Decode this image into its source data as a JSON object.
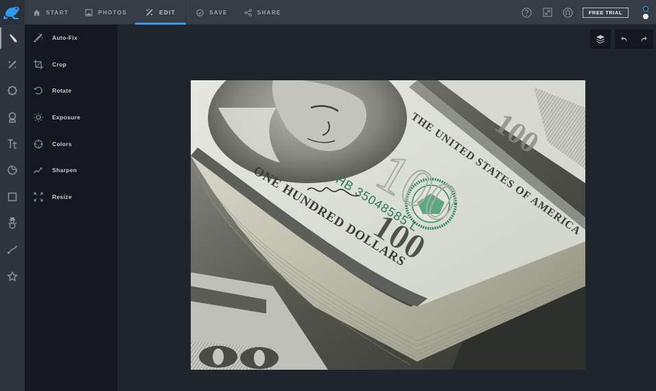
{
  "app": {
    "logo_icon": "frog-logo-icon",
    "accent_color": "#3d9ae0"
  },
  "topbar": {
    "nav": [
      {
        "label": "START",
        "icon": "home-icon",
        "active": false
      },
      {
        "label": "PHOTOS",
        "icon": "image-icon",
        "active": false
      },
      {
        "label": "EDIT",
        "icon": "magic-wand-icon",
        "active": true
      },
      {
        "label": "SAVE",
        "icon": "check-circle-icon",
        "active": false
      },
      {
        "label": "SHARE",
        "icon": "share-icon",
        "active": false
      }
    ],
    "right": {
      "help_icon": "help-icon",
      "fullscreen_icon": "fullscreen-icon",
      "account_icon": "account-icon",
      "free_trial_label": "FREE TRIAL"
    }
  },
  "rail": {
    "items": [
      {
        "name": "basic-edits",
        "icon": "pencil-icon",
        "active": true
      },
      {
        "name": "effects",
        "icon": "magic-wand-icon",
        "active": false
      },
      {
        "name": "frames",
        "icon": "gear-frame-icon",
        "active": false
      },
      {
        "name": "touch-up",
        "icon": "portrait-icon",
        "active": false
      },
      {
        "name": "text",
        "icon": "text-icon",
        "active": false
      },
      {
        "name": "overlays",
        "icon": "sticker-icon",
        "active": false
      },
      {
        "name": "borders",
        "icon": "square-icon",
        "active": false
      },
      {
        "name": "seasonal",
        "icon": "snowman-icon",
        "active": false
      },
      {
        "name": "draw",
        "icon": "brush-stroke-icon",
        "active": false
      },
      {
        "name": "favorites",
        "icon": "star-icon",
        "active": false
      }
    ]
  },
  "submenu": {
    "items": [
      {
        "label": "Auto-Fix",
        "icon": "auto-fix-icon"
      },
      {
        "label": "Crop",
        "icon": "crop-icon"
      },
      {
        "label": "Rotate",
        "icon": "rotate-icon"
      },
      {
        "label": "Exposure",
        "icon": "exposure-icon"
      },
      {
        "label": "Colors",
        "icon": "colors-icon"
      },
      {
        "label": "Sharpen",
        "icon": "sharpen-icon"
      },
      {
        "label": "Resize",
        "icon": "resize-icon"
      }
    ]
  },
  "canvas": {
    "tools": {
      "layers_icon": "layers-icon",
      "undo_icon": "undo-icon",
      "redo_icon": "redo-icon"
    },
    "photo": {
      "description": "Stack of hundred dollar bills",
      "serial": "HB 35048585 L",
      "bill_text_top": "THE UNITED STATES OF AMERICA",
      "bill_text_bottom": "ONE HUNDRED DOLLARS",
      "denomination": "100"
    }
  }
}
